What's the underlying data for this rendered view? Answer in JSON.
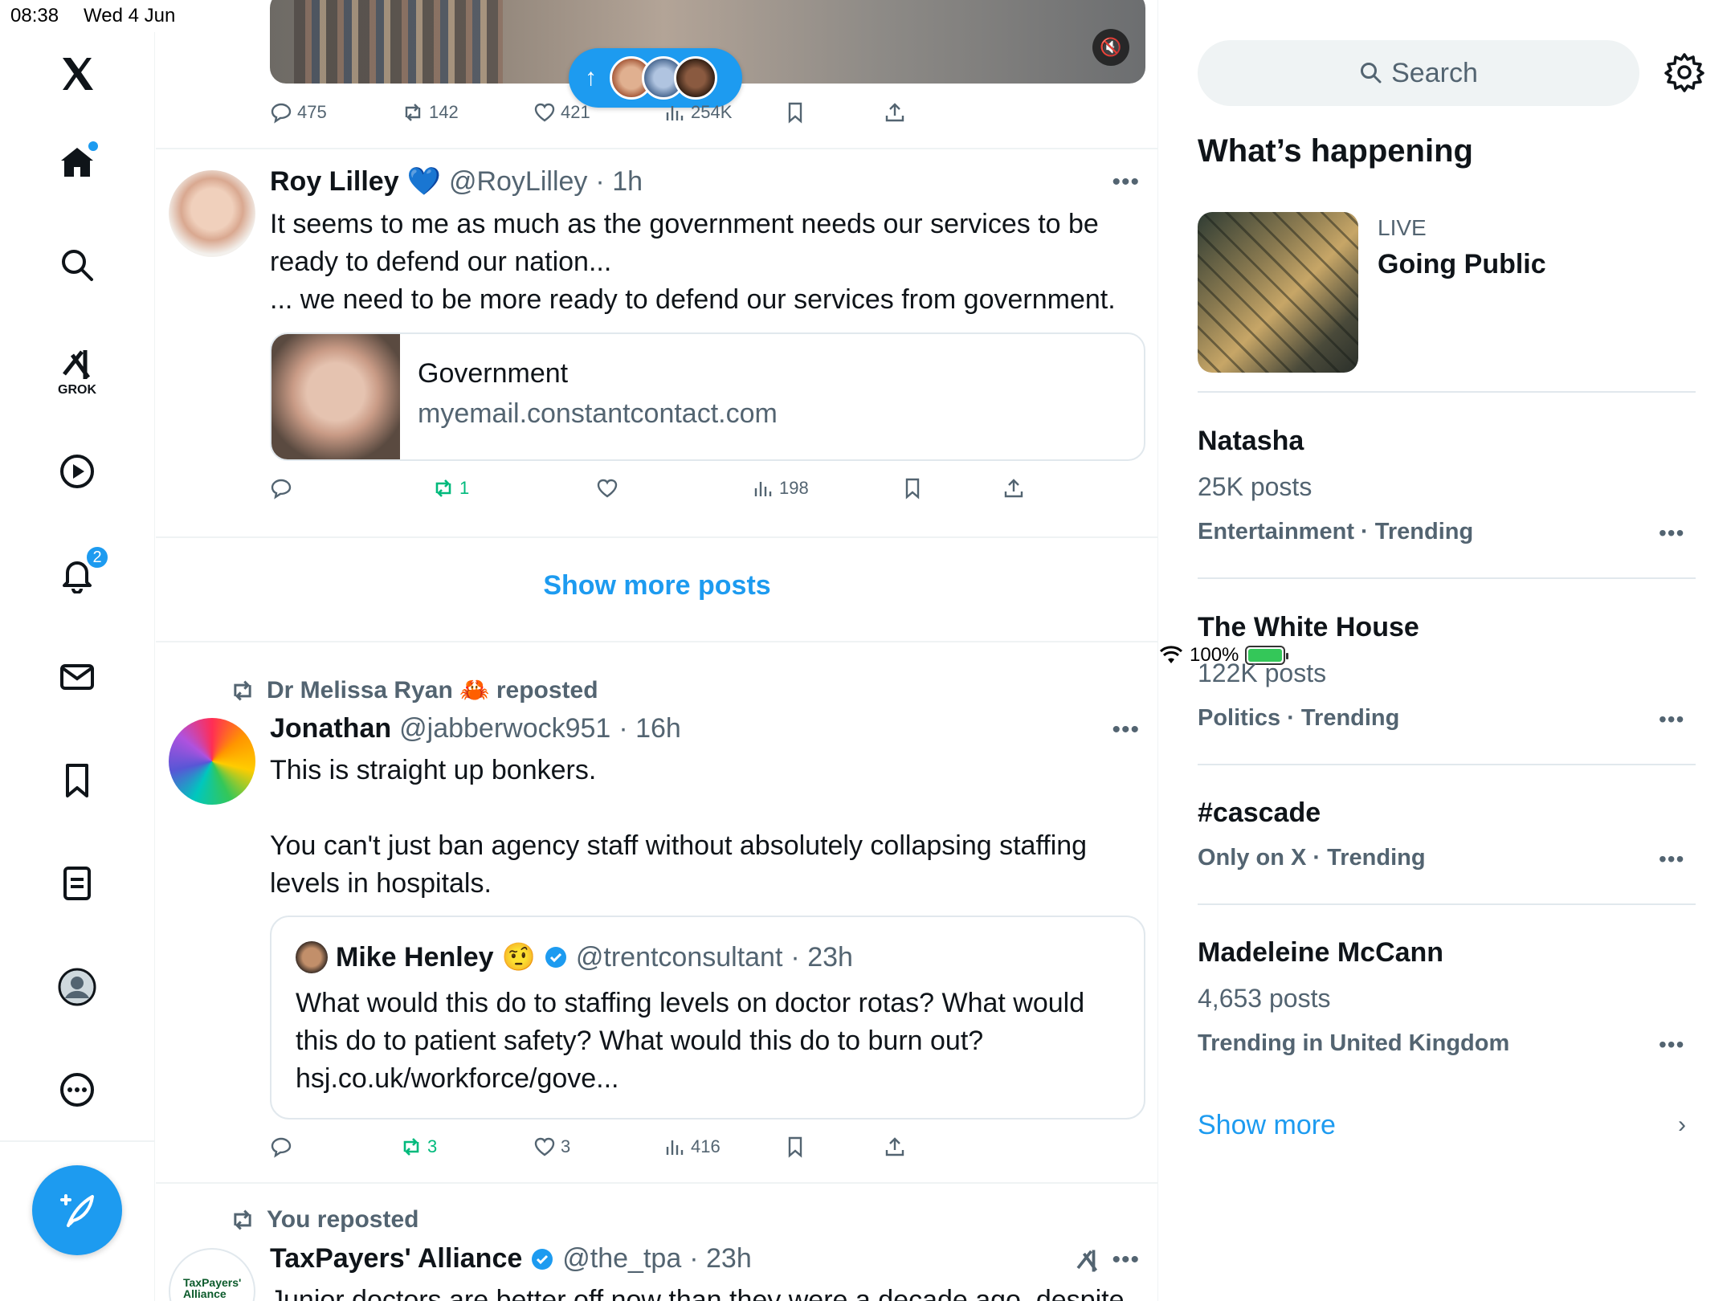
{
  "status_bar": {
    "time": "08:38",
    "date": "Wed 4 Jun",
    "battery": "100%"
  },
  "nav": {
    "grok_label": "GROK",
    "notifications_badge": "2",
    "icons": [
      "x-logo-icon",
      "home-icon",
      "search-icon",
      "grok-icon",
      "video-icon",
      "notifications-icon",
      "messages-icon",
      "bookmarks-icon",
      "lists-icon",
      "profile-icon",
      "more-icon",
      "compose-icon"
    ]
  },
  "top_post": {
    "replies": "475",
    "reposts": "142",
    "likes": "421",
    "views": "254K"
  },
  "post1": {
    "name": "Roy Lilley",
    "emoji": "💙",
    "handle": "@RoyLilley",
    "time": "· 1h",
    "line1": "It seems to me as much as the government needs our services to be",
    "line2": "ready to defend our nation...",
    "line3": "... we need to be more ready to defend our services from government.",
    "card_title": "Government",
    "card_domain": "myemail.constantcontact.com",
    "reposts": "1",
    "views": "198"
  },
  "show_more_posts": "Show more posts",
  "post2": {
    "reposted_by": "Dr Melissa Ryan",
    "reposted_emoji": "🦀",
    "reposted_label": "reposted",
    "name": "Jonathan",
    "handle": "@jabberwock951",
    "time": "· 16h",
    "line1": "This is straight up bonkers.",
    "line2": "You can't just ban agency staff without absolutely collapsing staffing",
    "line3": "levels in hospitals.",
    "quote": {
      "name": "Mike Henley",
      "emoji": "🤨",
      "handle": "@trentconsultant",
      "time": "· 23h",
      "line1": "What would this do to staffing levels on doctor rotas? What would",
      "line2": "this do to patient safety? What would this do to burn out?",
      "line3": "hsj.co.uk/workforce/gove..."
    },
    "reposts": "3",
    "likes": "3",
    "views": "416"
  },
  "post3": {
    "reposted_label": "You reposted",
    "name": "TaxPayers' Alliance",
    "handle": "@the_tpa",
    "time": "· 23h",
    "avatar_text": "TaxPayers' Alliance",
    "line1": "Junior doctors are better off now than they were a decade ago, despite"
  },
  "right": {
    "search_placeholder": "Search",
    "section_title": "What’s happening",
    "live_label": "LIVE",
    "live_title": "Going Public",
    "trends": [
      {
        "title": "Natasha",
        "posts": "25K posts",
        "category": "Entertainment · Trending"
      },
      {
        "title": "The White House",
        "posts": "122K posts",
        "category": "Politics · Trending"
      },
      {
        "title": "#cascade",
        "posts": "",
        "category": "Only on X · Trending"
      },
      {
        "title": "Madeleine McCann",
        "posts": "4,653 posts",
        "category": "Trending in United Kingdom"
      }
    ],
    "show_more": "Show more"
  },
  "colors": {
    "accent": "#1d9bf0",
    "repost_green": "#00ba7c",
    "muted": "#536471"
  }
}
